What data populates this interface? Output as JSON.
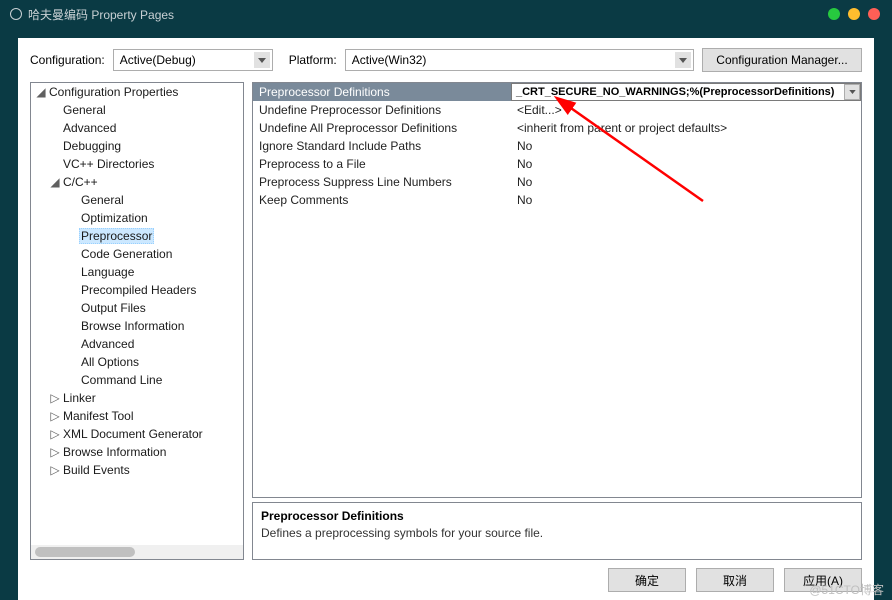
{
  "window": {
    "title": "哈夫曼编码 Property Pages"
  },
  "toolbar": {
    "config_label": "Configuration:",
    "config_value": "Active(Debug)",
    "platform_label": "Platform:",
    "platform_value": "Active(Win32)",
    "manager_label": "Configuration Manager..."
  },
  "tree": {
    "root": "Configuration Properties",
    "items_l2": [
      {
        "label": "General",
        "exp": ""
      },
      {
        "label": "Advanced",
        "exp": ""
      },
      {
        "label": "Debugging",
        "exp": ""
      },
      {
        "label": "VC++ Directories",
        "exp": ""
      }
    ],
    "cpp": {
      "label": "C/C++",
      "children": [
        "General",
        "Optimization",
        "Preprocessor",
        "Code Generation",
        "Language",
        "Precompiled Headers",
        "Output Files",
        "Browse Information",
        "Advanced",
        "All Options",
        "Command Line"
      ],
      "selected_index": 2
    },
    "rest": [
      {
        "label": "Linker"
      },
      {
        "label": "Manifest Tool"
      },
      {
        "label": "XML Document Generator"
      },
      {
        "label": "Browse Information"
      },
      {
        "label": "Build Events"
      }
    ]
  },
  "grid": {
    "header": {
      "name": "Preprocessor Definitions",
      "value": "_CRT_SECURE_NO_WARNINGS;%(PreprocessorDefinitions)"
    },
    "rows": [
      {
        "name": "Undefine Preprocessor Definitions",
        "value": "<Edit...>"
      },
      {
        "name": "Undefine All Preprocessor Definitions",
        "value": "<inherit from parent or project defaults>"
      },
      {
        "name": "Ignore Standard Include Paths",
        "value": "No"
      },
      {
        "name": "Preprocess to a File",
        "value": "No"
      },
      {
        "name": "Preprocess Suppress Line Numbers",
        "value": "No"
      },
      {
        "name": "Keep Comments",
        "value": "No"
      }
    ]
  },
  "desc": {
    "title": "Preprocessor Definitions",
    "body": "Defines a preprocessing symbols for your source file."
  },
  "footer": {
    "ok": "确定",
    "cancel": "取消",
    "apply": "应用(A)"
  },
  "watermark": "@51CTO博客"
}
